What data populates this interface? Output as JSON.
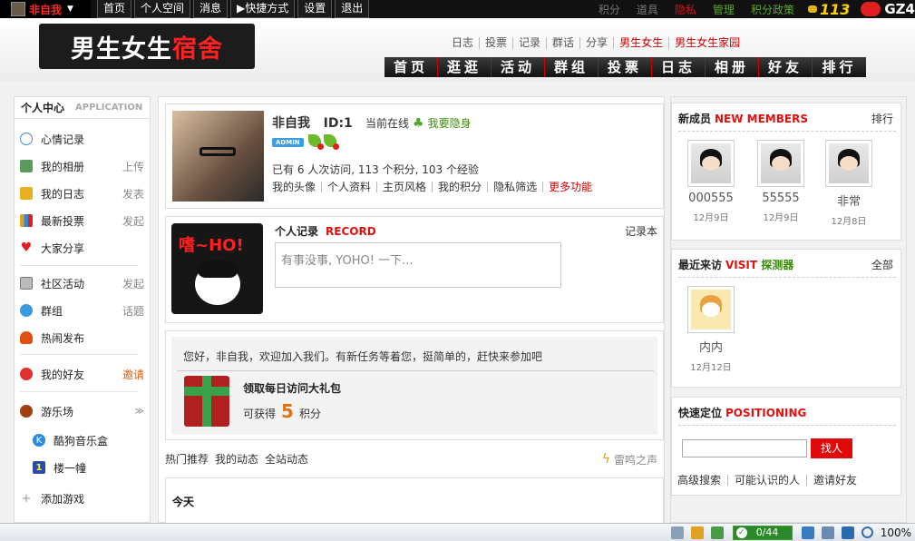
{
  "topbar": {
    "username": "非自我",
    "nav": [
      "首页",
      "个人空间",
      "消息",
      "▶快捷方式",
      "设置",
      "退出"
    ],
    "right_links": [
      {
        "label": "积分",
        "color": "#777777"
      },
      {
        "label": "道具",
        "color": "#777777"
      },
      {
        "label": "隐私",
        "color": "#e01010"
      },
      {
        "label": "管理",
        "color": "#5aa62a"
      },
      {
        "label": "积分政策",
        "color": "#5aa62a"
      }
    ],
    "score": "113",
    "brand": "GZ4"
  },
  "header": {
    "logo_main": "男生女生",
    "logo_accent": "宿舍",
    "sublinks": [
      "日志",
      "投票",
      "记录",
      "群话",
      "分享",
      "男生女生",
      "男生女生家园"
    ],
    "main_nav": [
      "首页",
      "逛逛",
      "活动",
      "群组",
      "投票",
      "日志",
      "相册",
      "好友",
      "排行"
    ]
  },
  "sidebar": {
    "title": "个人中心",
    "subtitle": "APPLICATION",
    "items": [
      {
        "label": "心情记录",
        "action": "",
        "icon": "speech-bubble-icon",
        "color": "#3a8ad0"
      },
      {
        "label": "我的相册",
        "action": "上传",
        "icon": "photo-icon",
        "color": "#4a8a4a"
      },
      {
        "label": "我的日志",
        "action": "发表",
        "icon": "blog-icon",
        "color": "#e0a020"
      },
      {
        "label": "最新投票",
        "action": "发起",
        "icon": "chart-icon",
        "color": "#2a8ae0"
      },
      {
        "label": "大家分享",
        "action": "",
        "icon": "heart-icon",
        "color": "#e02020"
      },
      {
        "label": "社区活动",
        "action": "发起",
        "icon": "calendar-icon",
        "color": "#888888"
      },
      {
        "label": "群组",
        "action": "话题",
        "icon": "group-icon",
        "color": "#3a9ae0"
      },
      {
        "label": "热闹发布",
        "action": "",
        "icon": "fire-icon",
        "color": "#e05010"
      },
      {
        "label": "我的好友",
        "action": "邀请",
        "icon": "friend-icon",
        "color": "#e03030"
      },
      {
        "label": "游乐场",
        "action": "",
        "icon": "game-icon",
        "color": "#a04010"
      },
      {
        "label": "酷狗音乐盒",
        "action": "",
        "icon": "music-icon",
        "color": "#2a8ae0"
      },
      {
        "label": "楼一幢",
        "action": "",
        "icon": "building-icon",
        "color": "#2a4ab0"
      },
      {
        "label": "添加游戏",
        "action": "",
        "icon": "plus-icon",
        "color": "#999999"
      }
    ]
  },
  "profile": {
    "name": "非自我",
    "id": "ID:1",
    "online": "当前在线",
    "hide": "我要隐身",
    "badge": "ADMIN",
    "stats": "已有 6 人次访问, 113 个积分, 103 个经验",
    "links": [
      "我的头像",
      "个人资料",
      "主页风格",
      "我的积分",
      "隐私筛选",
      "更多功能"
    ]
  },
  "record": {
    "title": "个人记录",
    "title_en": "RECORD",
    "book": "记录本",
    "img_text": "嗜~HO!",
    "placeholder": "有事没事, YOHO! 一下..."
  },
  "welcome": {
    "message": "您好，非自我，欢迎加入我们。有新任务等着您，挺简单的，赶快来参加吧",
    "gift_title": "领取每日访问大礼包",
    "points_label": "可获得",
    "points": "5",
    "points_unit": "积分"
  },
  "feed": {
    "tabs": [
      "热门推荐",
      "我的动态",
      "全站动态"
    ],
    "right": "雷鸣之声",
    "today": "今天"
  },
  "new_members": {
    "title": "新成员",
    "title_en": "NEW MEMBERS",
    "link": "排行",
    "members": [
      {
        "name": "000555",
        "date": "12月9日"
      },
      {
        "name": "55555",
        "date": "12月9日"
      },
      {
        "name": "非常",
        "date": "12月8日"
      }
    ]
  },
  "visitors": {
    "title": "最近来访",
    "title_en": "VISIT",
    "detector": "探测器",
    "link": "全部",
    "list": [
      {
        "name": "内内",
        "date": "12月12日"
      }
    ]
  },
  "locate": {
    "title": "快速定位",
    "title_en": "POSITIONING",
    "button": "找人",
    "input_value": "",
    "links": [
      "高级搜索",
      "可能认识的人",
      "邀请好友"
    ]
  },
  "statusbar": {
    "progress": "0/44",
    "zoom": "100%"
  }
}
